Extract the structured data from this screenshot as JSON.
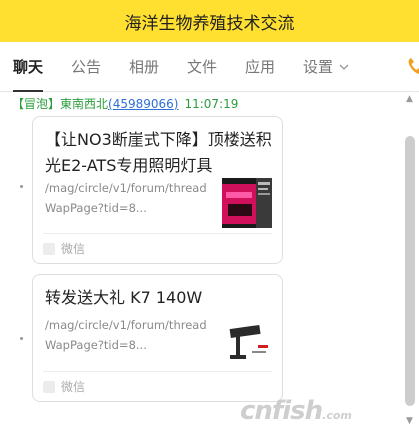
{
  "header": {
    "title": "海洋生物养殖技术交流"
  },
  "tabs": [
    {
      "label": "聊天",
      "active": true
    },
    {
      "label": "公告"
    },
    {
      "label": "相册"
    },
    {
      "label": "文件"
    },
    {
      "label": "应用"
    },
    {
      "label": "设置"
    }
  ],
  "message": {
    "tag": "【冒泡】",
    "sender": "東南西北",
    "sender_id_open": "(",
    "sender_id": "45989066",
    "sender_id_close": ")",
    "time": "11:07:19"
  },
  "cards": [
    {
      "title": "【让NO3断崖式下降】顶楼送积光E2-ATS专用照明灯具",
      "url": "/mag/circle/v1/forum/threadWapPage?tid=8...",
      "source": "微信",
      "thumb_icon": "product-thumbnail-red"
    },
    {
      "title": "转发送大礼 K7 140W",
      "url": "/mag/circle/v1/forum/threadWapPage?tid=8...",
      "source": "微信",
      "thumb_icon": "lamp-thumbnail"
    }
  ],
  "watermark": {
    "text": "cnfish",
    "suffix": ".com"
  },
  "colors": {
    "header_bg": "#ffe030",
    "sender_green": "#2a9d3a",
    "link_blue": "#2f6fd6"
  }
}
